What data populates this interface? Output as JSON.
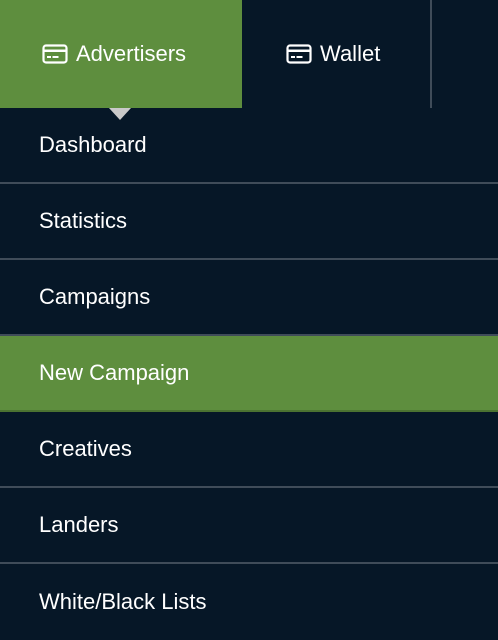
{
  "colors": {
    "background": "#061727",
    "active": "#5e8e3e",
    "divider": "#3f4c59",
    "text": "#ffffff"
  },
  "tabs": [
    {
      "label": "Advertisers",
      "icon": "credit-card-icon",
      "active": true
    },
    {
      "label": "Wallet",
      "icon": "credit-card-icon",
      "active": false
    }
  ],
  "menu": {
    "items": [
      {
        "label": "Dashboard",
        "active": false
      },
      {
        "label": "Statistics",
        "active": false
      },
      {
        "label": "Campaigns",
        "active": false
      },
      {
        "label": "New Campaign",
        "active": true
      },
      {
        "label": "Creatives",
        "active": false
      },
      {
        "label": "Landers",
        "active": false
      },
      {
        "label": "White/Black Lists",
        "active": false
      }
    ]
  }
}
